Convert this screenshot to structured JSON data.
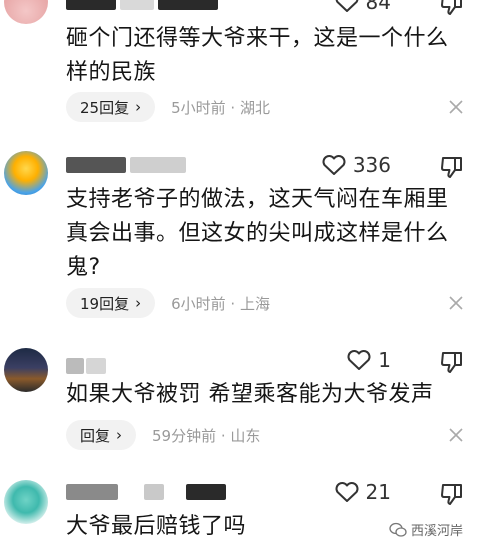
{
  "comments": [
    {
      "likes": "84",
      "text": "砸个门还得等大爷来干，这是一个什么样的民族",
      "reply_label": "25回复",
      "time_loc": "5小时前 · 湖北"
    },
    {
      "likes": "336",
      "text": "支持老爷子的做法，这天气闷在车厢里真会出事。但这女的尖叫成这样是什么鬼?",
      "reply_label": "19回复",
      "time_loc": "6小时前 · 上海"
    },
    {
      "likes": "1",
      "text": "如果大爷被罚 希望乘客能为大爷发声",
      "reply_label": "回复",
      "time_loc": "59分钟前 · 山东"
    },
    {
      "likes": "21",
      "text": "大爷最后赔钱了吗"
    }
  ],
  "watermark": "西溪河岸",
  "icons": {
    "like": "heart-outline-icon",
    "dislike": "thumbs-down-icon",
    "close": "close-icon",
    "chevron": "chevron-right-icon",
    "watermark": "wechat-logo-icon"
  }
}
